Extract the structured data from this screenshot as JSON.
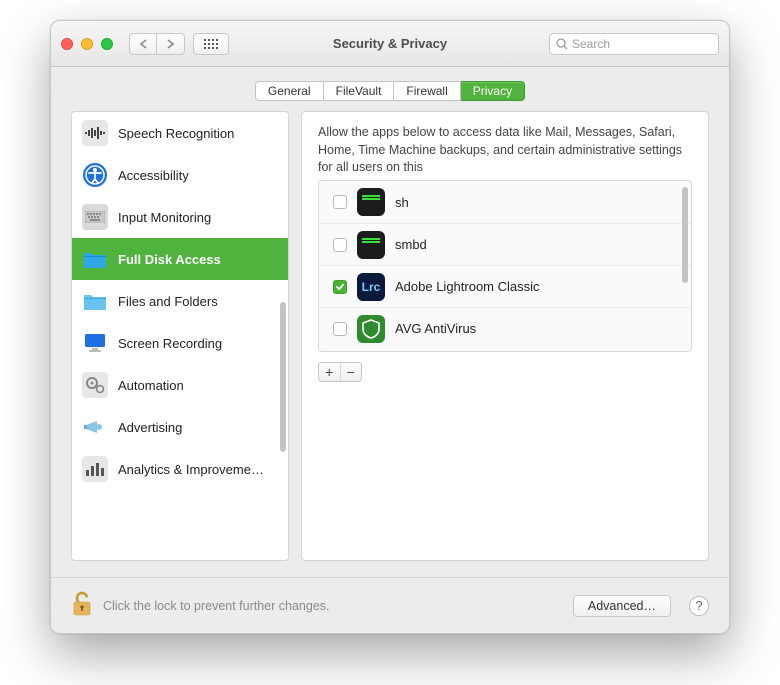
{
  "window": {
    "title": "Security & Privacy",
    "search_placeholder": "Search"
  },
  "tabs": [
    {
      "label": "General"
    },
    {
      "label": "FileVault"
    },
    {
      "label": "Firewall"
    },
    {
      "label": "Privacy"
    }
  ],
  "active_tab": 3,
  "sidebar": {
    "items": [
      {
        "label": "Speech Recognition",
        "icon": "speech-icon"
      },
      {
        "label": "Accessibility",
        "icon": "accessibility-icon"
      },
      {
        "label": "Input Monitoring",
        "icon": "keyboard-icon"
      },
      {
        "label": "Full Disk Access",
        "icon": "folder-icon"
      },
      {
        "label": "Files and Folders",
        "icon": "folder-light-icon"
      },
      {
        "label": "Screen Recording",
        "icon": "monitor-icon"
      },
      {
        "label": "Automation",
        "icon": "gears-icon"
      },
      {
        "label": "Advertising",
        "icon": "megaphone-icon"
      },
      {
        "label": "Analytics & Improveme…",
        "icon": "barchart-icon"
      }
    ],
    "selected": 3
  },
  "main": {
    "description": "Allow the apps below to access data like Mail, Messages, Safari, Home, Time Machine backups, and certain administrative settings for all users on this",
    "apps": [
      {
        "name": "sh",
        "checked": false,
        "icon": "terminal"
      },
      {
        "name": "smbd",
        "checked": false,
        "icon": "terminal"
      },
      {
        "name": "Adobe Lightroom Classic",
        "checked": true,
        "icon": "lrc"
      },
      {
        "name": "AVG AntiVirus",
        "checked": false,
        "icon": "avg"
      }
    ]
  },
  "footer": {
    "lock_text": "Click the lock to prevent further changes.",
    "advanced_label": "Advanced…",
    "help_label": "?"
  }
}
